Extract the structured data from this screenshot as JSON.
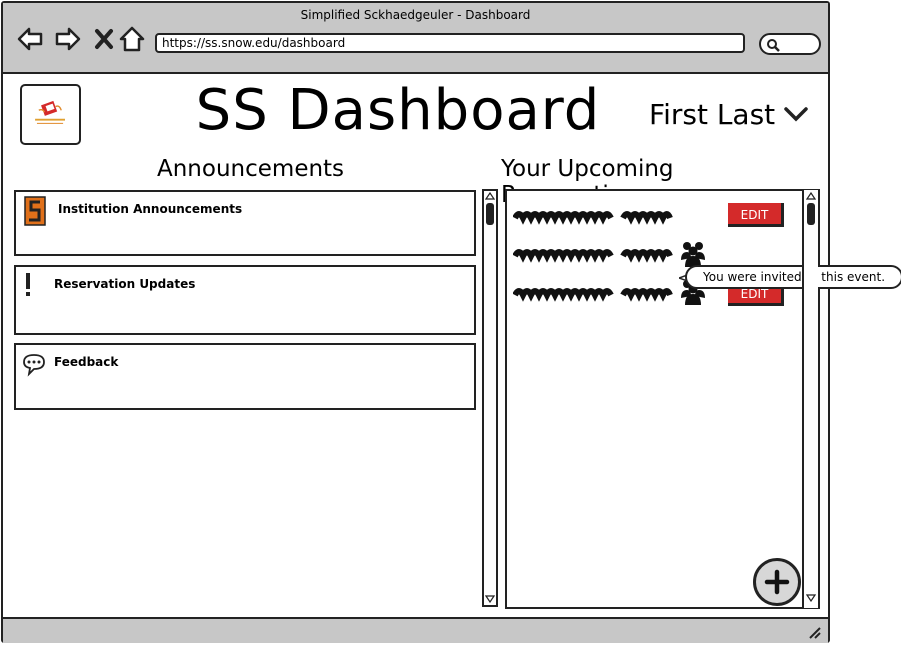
{
  "window": {
    "title": "Simplified Sckhaedgeuler - Dashboard"
  },
  "browser": {
    "url": "https://ss.snow.edu/dashboard",
    "nav_icons": [
      "back-arrow-icon",
      "forward-arrow-icon",
      "stop-icon",
      "home-icon"
    ],
    "search_icon": "magnifier-icon"
  },
  "header": {
    "title": "SS Dashboard",
    "user_name": "First Last",
    "user_menu_icon": "chevron-down-icon"
  },
  "announcements": {
    "heading": "Announcements",
    "cards": [
      {
        "title": "Institution Announcements",
        "icon": "snow-college-s-icon"
      },
      {
        "title": "Reservation Updates",
        "icon": "exclamation-icon"
      },
      {
        "title": "Feedback",
        "icon": "speech-bubble-icon"
      }
    ]
  },
  "reservations": {
    "heading": "Your Upcoming Reservations:",
    "rows": [
      {
        "edit_label": "EDIT",
        "invited": false
      },
      {
        "edit_label": "",
        "invited": true
      },
      {
        "edit_label": "EDIT",
        "invited": true
      }
    ],
    "tooltip": "You were invited to this event.",
    "add_icon": "plus-icon"
  },
  "colors": {
    "chrome": "#c7c7c7",
    "edit_button": "#d42a2a",
    "logo_accent": "#d42a2a"
  }
}
